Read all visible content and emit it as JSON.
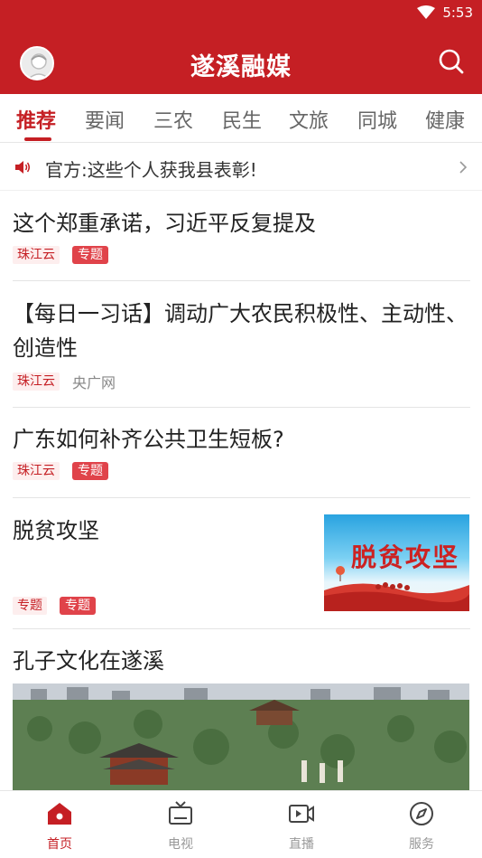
{
  "status": {
    "time": "5:53",
    "wifi_icon": "wifi-icon"
  },
  "header": {
    "title": "遂溪融媒",
    "avatar_icon": "avatar-icon",
    "search_icon": "search-icon"
  },
  "tabs": [
    {
      "label": "推荐",
      "active": true
    },
    {
      "label": "要闻"
    },
    {
      "label": "三农"
    },
    {
      "label": "民生"
    },
    {
      "label": "文旅"
    },
    {
      "label": "同城"
    },
    {
      "label": "健康"
    }
  ],
  "notice": {
    "text": "官方:这些个人获我县表彰!",
    "icon": "speaker-icon"
  },
  "feed": [
    {
      "title": "这个郑重承诺，习近平反复提及",
      "source": "珠江云",
      "topic": "专题"
    },
    {
      "title": "【每日一习话】调动广大农民积极性、主动性、创造性",
      "source": "珠江云",
      "extra": "央广网"
    },
    {
      "title": "广东如何补齐公共卫生短板?",
      "source": "珠江云",
      "topic": "专题"
    },
    {
      "title": "脱贫攻坚",
      "source": "专题",
      "topic": "专题",
      "image_text": "脱贫攻坚"
    },
    {
      "title": "孔子文化在遂溪"
    }
  ],
  "bottom_nav": [
    {
      "label": "首页",
      "icon": "home-icon",
      "active": true
    },
    {
      "label": "电视",
      "icon": "tv-icon"
    },
    {
      "label": "直播",
      "icon": "live-video-icon"
    },
    {
      "label": "服务",
      "icon": "compass-icon"
    }
  ],
  "colors": {
    "brand": "#c51f24",
    "tag_bg": "#fdeeee",
    "topic_bg": "#e0434a"
  }
}
